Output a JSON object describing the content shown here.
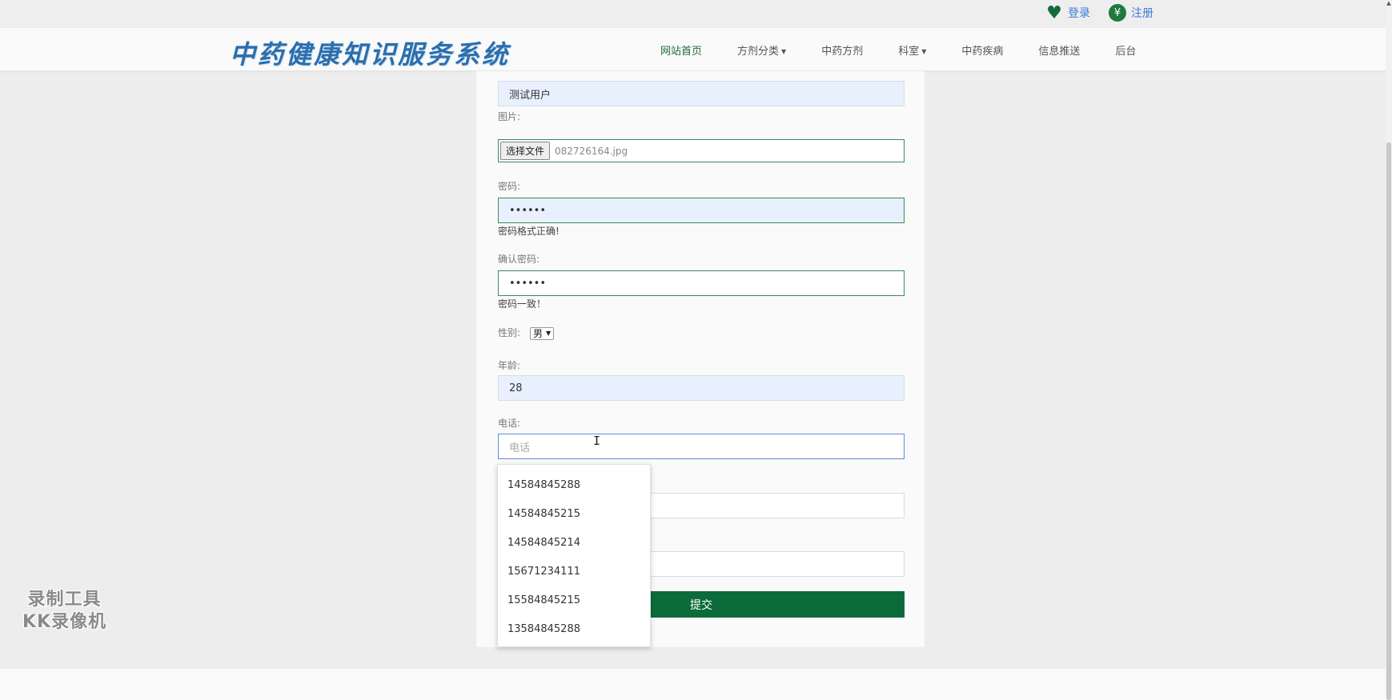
{
  "topbar": {
    "login_icon": "heart-icon",
    "login_label": "登录",
    "register_icon": "yen-icon",
    "register_label": "注册"
  },
  "header": {
    "logo_text": "中药健康知识服务系统",
    "nav": [
      {
        "label": "网站首页",
        "active": true
      },
      {
        "label": "方剂分类",
        "dropdown": true
      },
      {
        "label": "中药方剂"
      },
      {
        "label": "科室",
        "dropdown": true
      },
      {
        "label": "中药疾病"
      },
      {
        "label": "信息推送"
      },
      {
        "label": "后台"
      }
    ]
  },
  "form": {
    "name_value": "测试用户",
    "image_label": "图片:",
    "file_button": "选择文件",
    "file_name": "082726164.jpg",
    "password_label": "密码:",
    "password_value": "••••••",
    "password_hint": "密码格式正确!",
    "confirm_label": "确认密码:",
    "confirm_value": "••••••",
    "confirm_hint": "密码一致！",
    "gender_label": "性别:",
    "gender_value": "男",
    "age_label": "年龄:",
    "age_value": "28",
    "phone_label": "电话:",
    "phone_placeholder": "电话",
    "submit_label": "提交"
  },
  "autocomplete": {
    "options": [
      "14584845288",
      "14584845215",
      "14584845214",
      "15671234111",
      "15584845215",
      "13584845288"
    ]
  },
  "watermark": {
    "line1": "录制工具",
    "line2": "KK录像机"
  },
  "colors": {
    "brand_green": "#0c6b3b",
    "link_blue": "#3a7bd5",
    "autofill_bg": "#e8f0fe"
  }
}
